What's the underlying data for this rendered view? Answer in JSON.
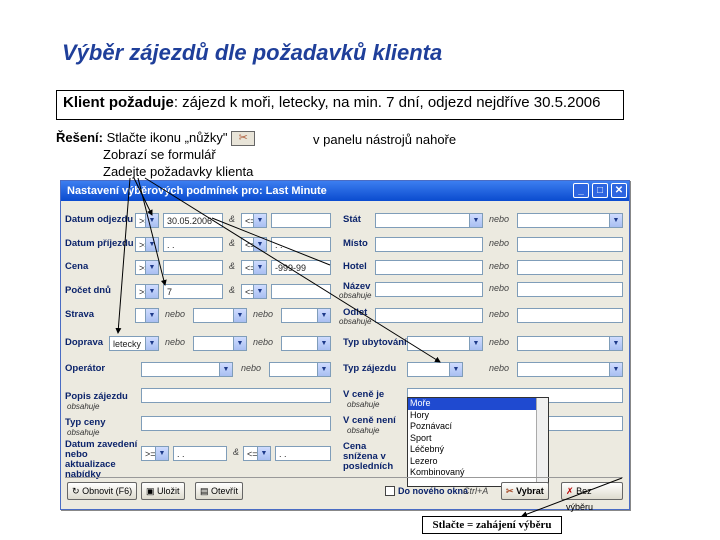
{
  "title": "Výběr zájezdů dle požadavků klienta",
  "request": {
    "label": "Klient požaduje",
    "text": ": zájezd k moři, letecky, na min. 7 dní, odjezd nejdříve 30.5.2006"
  },
  "solution": {
    "label": "Řešení:",
    "step1": "Stlačte ikonu „nůžky\"",
    "step1_suffix": "v panelu nástrojů nahoře",
    "step2": "Zobrazí se formulář",
    "step3": "Zadejte požadavky klienta"
  },
  "window": {
    "title": "Nastavení výběrových podmínek pro: Last Minute",
    "labels": {
      "datum_odjezdu": "Datum odjezdu",
      "datum_prijezdu": "Datum příjezdu",
      "cena": "Cena",
      "pocet_dnu": "Počet dnů",
      "strava": "Strava",
      "doprava": "Doprava",
      "operator": "Operátor",
      "popis": "Popis zájezdu",
      "popis_sub": "obsahuje",
      "typ_ceny": "Typ ceny",
      "typ_ceny_sub": "obsahuje",
      "datum_zavedeni": "Datum zavedení nebo aktualizace nabídky",
      "stat": "Stát",
      "misto": "Místo",
      "hotel": "Hotel",
      "nazev": "Název",
      "nazev_sub": "obsahuje",
      "odlet": "Odlet",
      "odlet_sub": "obsahuje",
      "typ_ubytovani": "Typ ubytování",
      "typ_zajezdu": "Typ zájezdu",
      "v_cene_je": "V ceně je",
      "v_cene_je_sub": "obsahuje",
      "v_cene_neni": "V ceně není",
      "v_cene_neni_sub": "obsahuje",
      "cena_snizena": "Cena snížena v posledních"
    },
    "values": {
      "odjezd_op": ">=",
      "odjezd_val": "30.05.2006",
      "odjezd_op2": "<=",
      "prijezd_op": ">=",
      "prijezd_val": ". .",
      "prijezd_op2": "<=",
      "prijezd_val2": ". .",
      "cena_op": ">=",
      "cena_op2": "<=",
      "cena_val2": "-999-99",
      "dny_op": ">=",
      "dny_val": "7",
      "dny_op2": "<=",
      "doprava_val": "letecky",
      "zavedeni_op": ">=",
      "zavedeni_val": ". .",
      "zavedeni_op2": "<=",
      "zavedeni_val2": ". ."
    },
    "nebo": "nebo",
    "typ_options": [
      "Moře",
      "Hory",
      "Poznávací",
      "Sport",
      "Léčebný",
      "Lezero",
      "Kombinovaný"
    ],
    "buttons": {
      "obnovit": "Obnovit (F6)",
      "ulozit": "Uložit",
      "otevrit": "Otevřít",
      "vybrat": "Vybrat",
      "bez_vyberu": "Bez výběru"
    },
    "novy_okno": "Do nového okna",
    "ctrl_hint": "Ctrl+A"
  },
  "final_label": "Stlačte = zahájení výběru"
}
